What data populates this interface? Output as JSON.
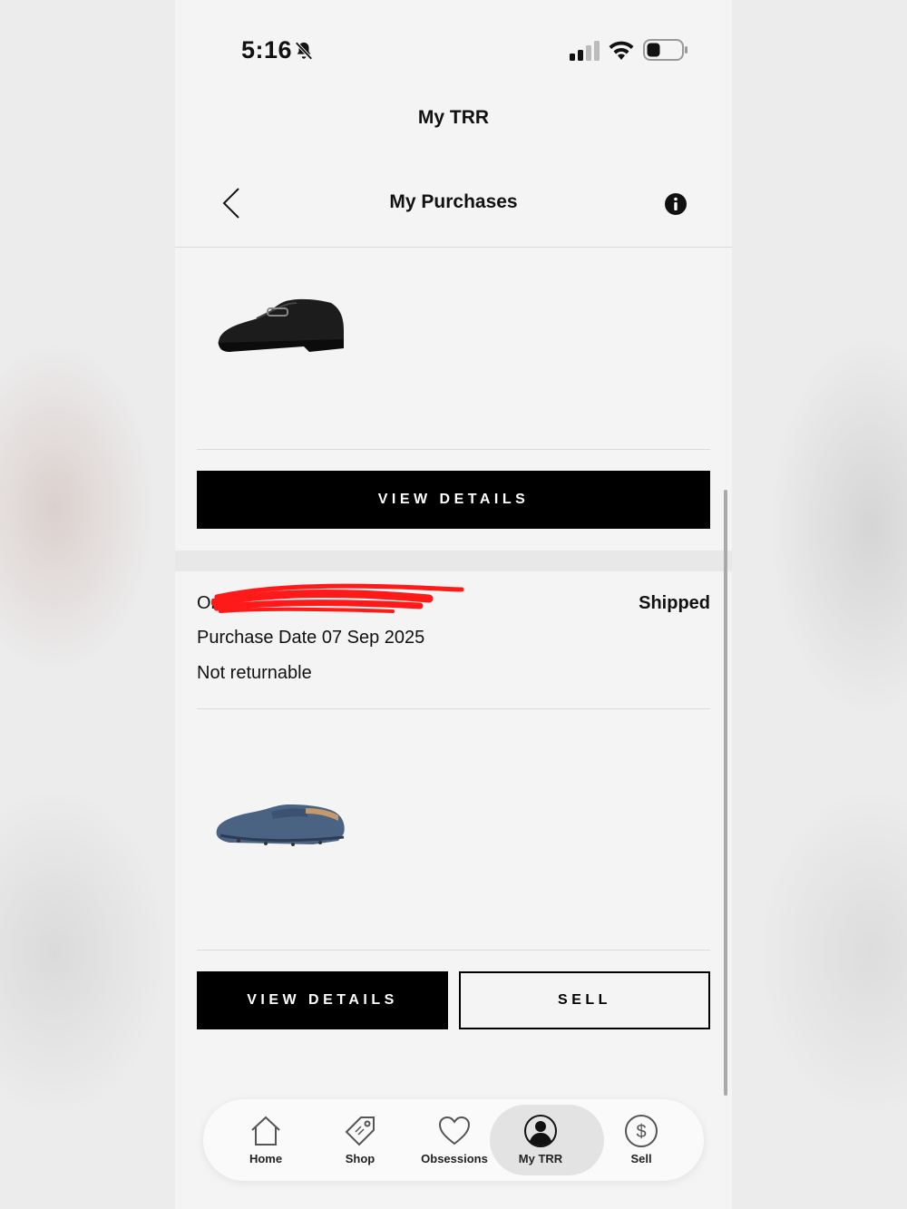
{
  "status_bar": {
    "time": "5:16"
  },
  "app": {
    "title": "My TRR"
  },
  "header": {
    "title": "My Purchases"
  },
  "orders": [
    {
      "item_icon": "black-loafer-image",
      "buttons": {
        "view_details": "VIEW DETAILS"
      }
    },
    {
      "order_label": "Or",
      "status": "Shipped",
      "purchase_date": "Purchase Date 07 Sep 2025",
      "returnable": "Not returnable",
      "item_icon": "blue-suede-driver-image",
      "buttons": {
        "view_details": "VIEW DETAILS",
        "sell": "SELL"
      }
    }
  ],
  "tabs": [
    {
      "label": "Home",
      "icon": "home-icon"
    },
    {
      "label": "Shop",
      "icon": "tag-icon"
    },
    {
      "label": "Obsessions",
      "icon": "heart-icon"
    },
    {
      "label": "My TRR",
      "icon": "user-icon",
      "active": true
    },
    {
      "label": "Sell",
      "icon": "dollar-icon"
    }
  ],
  "colors": {
    "background": "#f4f4f4",
    "primary_button": "#000000",
    "redaction": "#ff1a1a"
  }
}
